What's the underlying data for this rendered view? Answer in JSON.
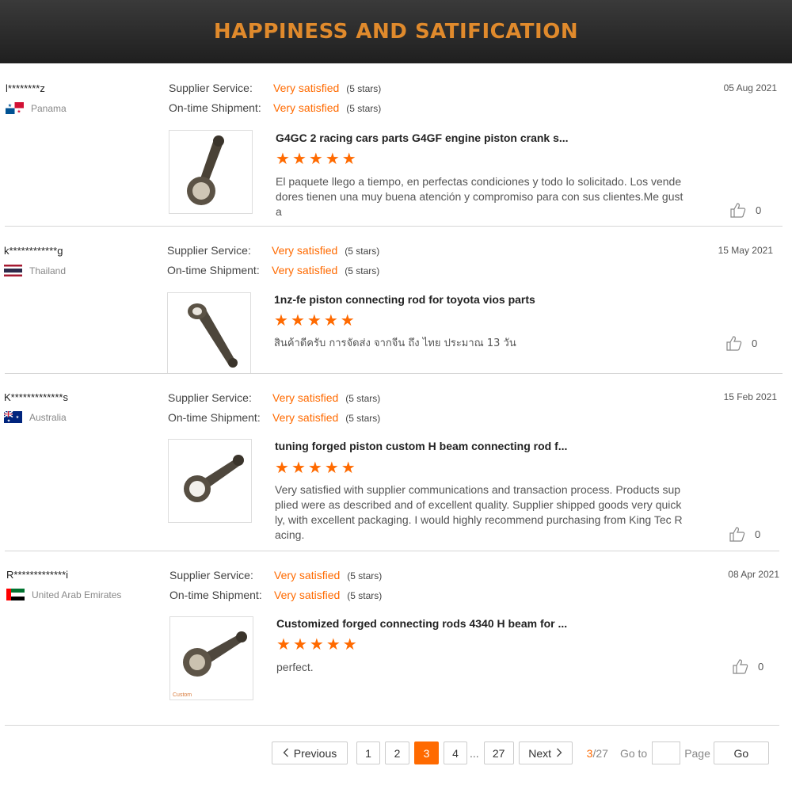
{
  "banner": {
    "title": "HAPPINESS AND SATIFICATION"
  },
  "labels": {
    "supplier_service": "Supplier Service:",
    "ontime_shipment": "On-time Shipment:"
  },
  "reviews": [
    {
      "buyer": "l********z",
      "country": "Panama",
      "flag": "panama-flag-icon",
      "supplier_service": "Very satisfied",
      "supplier_stars": "(5 stars)",
      "shipment": "Very satisfied",
      "shipment_stars": "(5 stars)",
      "date": "05 Aug 2021",
      "product_title": "G4GC 2 racing cars parts G4GF engine piston crank s...",
      "rating": 5,
      "feedback": "El paquete llego a tiempo, en perfectas condiciones y todo lo solicitado. Los vendedores tienen una muy buena atención y compromiso para con sus clientes.Me gusta",
      "likes": "0"
    },
    {
      "buyer": "k************g",
      "country": "Thailand",
      "flag": "thailand-flag-icon",
      "supplier_service": "Very satisfied",
      "supplier_stars": "(5 stars)",
      "shipment": "Very satisfied",
      "shipment_stars": "(5 stars)",
      "date": "15 May 2021",
      "product_title": "1nz-fe piston connecting rod for toyota vios parts",
      "rating": 5,
      "feedback": "สินค้าดีครับ การจัดส่ง จากจีน ถึง ไทย ประมาณ 13 วัน",
      "likes": "0"
    },
    {
      "buyer": "K*************s",
      "country": "Australia",
      "flag": "australia-flag-icon",
      "supplier_service": "Very satisfied",
      "supplier_stars": "(5 stars)",
      "shipment": "Very satisfied",
      "shipment_stars": "(5 stars)",
      "date": "15 Feb 2021",
      "product_title": "tuning forged piston custom H beam connecting rod f...",
      "rating": 5,
      "feedback": "Very satisfied with supplier communications and transaction process. Products supplied were as described and of excellent quality. Supplier shipped goods very quickly, with excellent packaging. I would highly recommend purchasing from King Tec Racing.",
      "likes": "0"
    },
    {
      "buyer": "R*************i",
      "country": "United Arab Emirates",
      "flag": "uae-flag-icon",
      "supplier_service": "Very satisfied",
      "supplier_stars": "(5 stars)",
      "shipment": "Very satisfied",
      "shipment_stars": "(5 stars)",
      "date": "08 Apr 2021",
      "product_title": "Customized forged connecting rods 4340 H beam for ...",
      "rating": 5,
      "feedback": "perfect.",
      "likes": "0",
      "thumb_tag": "Custom"
    }
  ],
  "pagination": {
    "previous": "Previous",
    "pages": [
      "1",
      "2",
      "3",
      "4"
    ],
    "ellipsis": "...",
    "last": "27",
    "active_page": "3",
    "next": "Next",
    "current": "3",
    "total": "/27",
    "goto_label": "Go to",
    "page_label": "Page",
    "go_button": "Go"
  },
  "colors": {
    "accent": "#ff6a00",
    "banner_text": "#e08a2c",
    "banner_bg": "#2b2b2b"
  }
}
